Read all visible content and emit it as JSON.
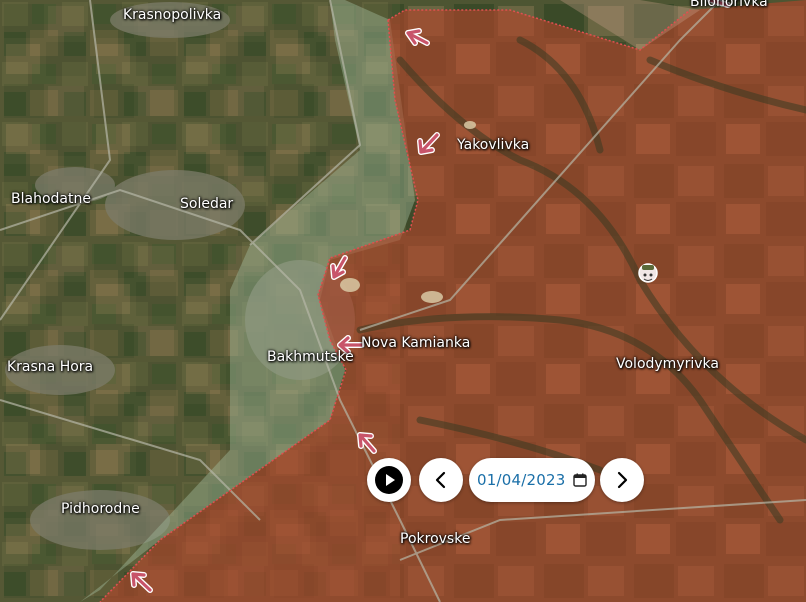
{
  "map": {
    "places": [
      {
        "id": "krasnopolivka",
        "name": "Krasnopolivka"
      },
      {
        "id": "bilohorivka",
        "name": "Bilohorivka"
      },
      {
        "id": "yakovlivka",
        "name": "Yakovlivka"
      },
      {
        "id": "blahodatne",
        "name": "Blahodatne"
      },
      {
        "id": "soledar",
        "name": "Soledar"
      },
      {
        "id": "nova-kamianka",
        "name": "Nova Kamianka"
      },
      {
        "id": "bakhmutske",
        "name": "Bakhmutske"
      },
      {
        "id": "krasna-hora",
        "name": "Krasna Hora"
      },
      {
        "id": "volodymyrivka",
        "name": "Volodymyrivka"
      },
      {
        "id": "pidhorodne",
        "name": "Pidhorodne"
      },
      {
        "id": "pokrovske",
        "name": "Pokrovske"
      }
    ],
    "colors": {
      "occupied_overlay": "#b5442a",
      "front_line": "#e05050",
      "arrow": "#c8546a"
    }
  },
  "controls": {
    "play_icon": "play-icon",
    "prev_icon": "chevron-left-icon",
    "next_icon": "chevron-right-icon",
    "date_value": "01/04/2023",
    "calendar_icon": "calendar-icon"
  }
}
